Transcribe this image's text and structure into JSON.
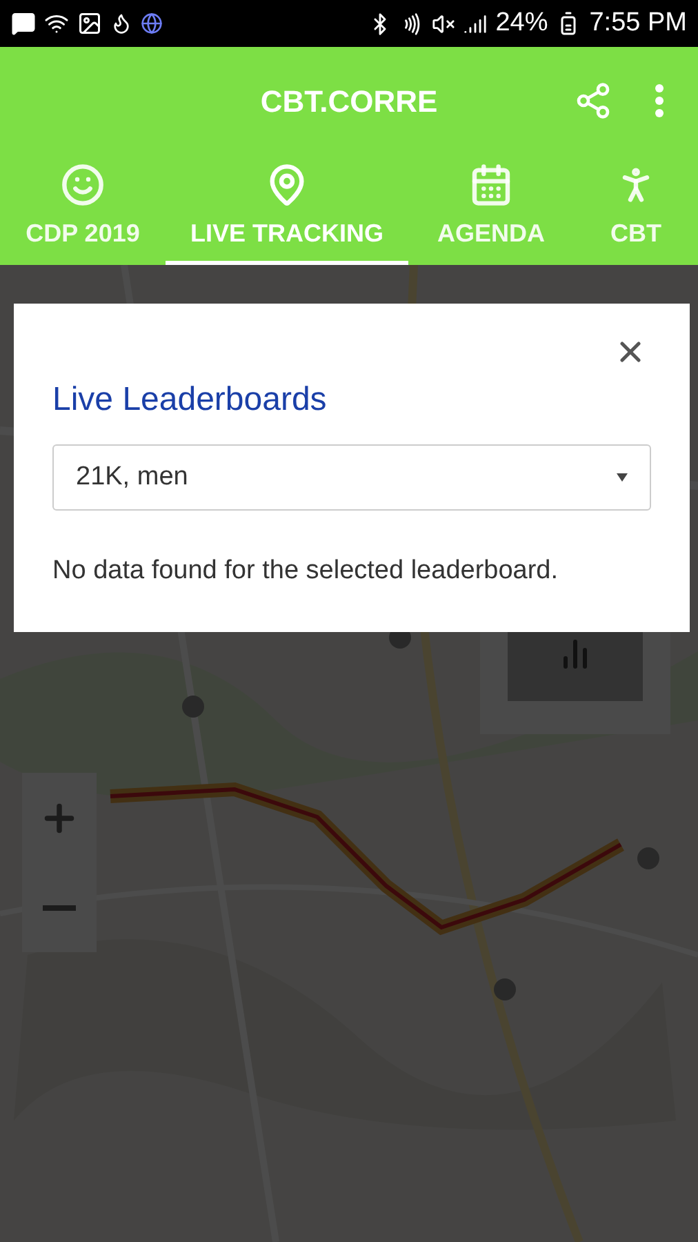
{
  "status_bar": {
    "battery": "24%",
    "time": "7:55 PM"
  },
  "app_bar": {
    "title": "CBT.CORRE"
  },
  "tabs": [
    {
      "label": "CDP 2019",
      "selected": false
    },
    {
      "label": "LIVE TRACKING",
      "selected": true
    },
    {
      "label": "AGENDA",
      "selected": false
    },
    {
      "label": "CBT",
      "selected": false
    }
  ],
  "dialog": {
    "title": "Live Leaderboards",
    "select": {
      "value": "21K, men"
    },
    "message": "No data found for the selected leaderboard."
  }
}
